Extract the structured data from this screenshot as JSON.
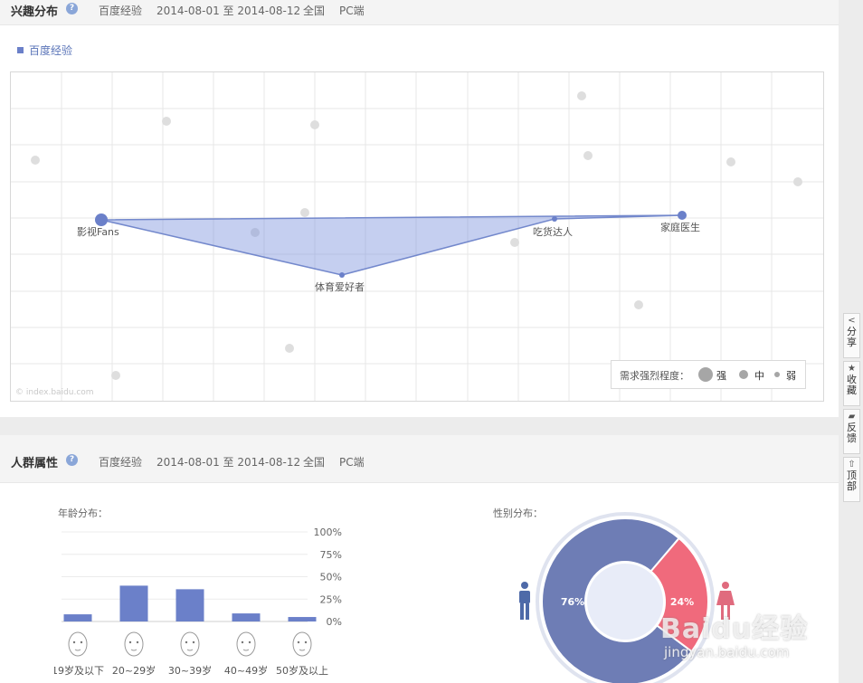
{
  "interest": {
    "title": "兴趣分布",
    "help": "?",
    "source": "百度经验",
    "date_range": "2014-08-01 至 2014-08-12",
    "region": "全国",
    "device": "PC端",
    "legend": "百度经验",
    "watermark": "© index.baidu.com",
    "strength": {
      "label": "需求强烈程度：",
      "strong": "强",
      "mid": "中",
      "weak": "弱"
    },
    "points": [
      {
        "label": "影视Fans",
        "size": "strong"
      },
      {
        "label": "体育爱好者",
        "size": "weak"
      },
      {
        "label": "吃货达人",
        "size": "weak"
      },
      {
        "label": "家庭医生",
        "size": "mid"
      }
    ]
  },
  "crowd": {
    "title": "人群属性",
    "help": "?",
    "source": "百度经验",
    "date_range": "2014-08-01 至 2014-08-12",
    "region": "全国",
    "device": "PC端",
    "age_title": "年龄分布：",
    "gender_title": "性别分布："
  },
  "chart_data": [
    {
      "type": "bar",
      "categories": [
        "19岁及以下",
        "20~29岁",
        "30~39岁",
        "40~49岁",
        "50岁及以上"
      ],
      "values": [
        8,
        40,
        36,
        9,
        5
      ],
      "yticks": [
        "100%",
        "75%",
        "50%",
        "25%",
        "0%"
      ],
      "ylim": [
        0,
        100
      ],
      "color": "#6b80c9"
    },
    {
      "type": "pie",
      "labels": [
        "76%",
        "24%"
      ],
      "values": [
        76,
        24
      ],
      "colors": [
        "#6e7db5",
        "#f06a7c"
      ]
    }
  ],
  "sidebar": [
    {
      "label": "分享",
      "icon": "share-icon"
    },
    {
      "label": "收藏",
      "icon": "star-icon"
    },
    {
      "label": "反馈",
      "icon": "feedback-icon"
    },
    {
      "label": "顶部",
      "icon": "top-icon"
    }
  ],
  "watermark": {
    "brand": "Baidu经验",
    "url": "jingyan.baidu.com"
  }
}
